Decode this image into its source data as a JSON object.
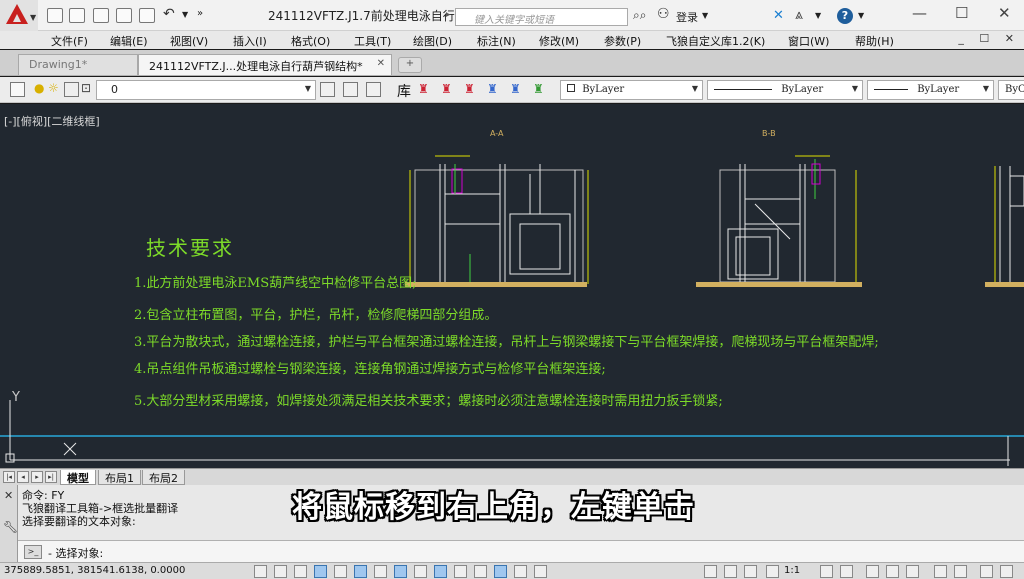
{
  "titlebar": {
    "document_title": "241112VFTZ.J1.7前处理电泳自行...",
    "search_placeholder": "键入关键字或短语",
    "login_label": "登录"
  },
  "menu": {
    "items": [
      "文件(F)",
      "编辑(E)",
      "视图(V)",
      "插入(I)",
      "格式(O)",
      "工具(T)",
      "绘图(D)",
      "标注(N)",
      "修改(M)",
      "参数(P)",
      "飞狼自定义库1.2(K)",
      "窗口(W)",
      "帮助(H)"
    ]
  },
  "tabs": [
    {
      "label": "Drawing1*"
    },
    {
      "label": "241112VFTZ.J...处理电泳自行葫芦钢结构*"
    }
  ],
  "toolbar": {
    "layer_value": "0",
    "lib_label": "库",
    "color_value": "ByLayer",
    "linetype_value": "ByLayer",
    "lineweight_value": "ByLayer",
    "plotstyle_value": "ByCo"
  },
  "canvas": {
    "view_label": "[-][俯视][二维线框]",
    "section_a": "A-A",
    "section_b": "B-B",
    "tech_title": "技术要求",
    "requirements": [
      "1.此方前处理电泳EMS葫芦线空中检修平台总图;",
      "2.包含立柱布置图，平台，护栏，吊杆，检修爬梯四部分组成。",
      "3.平台为散块式，通过螺栓连接，护栏与平台框架通过螺栓连接，吊杆上与钢梁螺接下与平台框架焊接，爬梯现场与平台框架配焊;",
      "4.吊点组件吊板通过螺栓与钢梁连接，连接角钢通过焊接方式与检修平台框架连接;",
      "5.大部分型材采用螺接，如焊接处须满足相关技术要求；螺接时必须注意螺栓连接时需用扭力扳手锁紧;"
    ],
    "ucs_y": "Y"
  },
  "layout_tabs": [
    "模型",
    "布局1",
    "布局2"
  ],
  "command": {
    "history": [
      "命令: FY",
      "飞狼翻译工具箱->框选批量翻译",
      "选择要翻译的文本对象:"
    ],
    "prompt_icon": ">_",
    "prompt": "- 选择对象:"
  },
  "subtitle": "将鼠标移到右上角，左键单击",
  "statusbar": {
    "coords": "375889.5851, 381541.6138, 0.0000",
    "scale": "1:1"
  },
  "colors": {
    "drawing_text": "#7ddb29",
    "canvas_bg": "#212830",
    "section_label": "#d2b060",
    "app_red": "#c8201e"
  }
}
